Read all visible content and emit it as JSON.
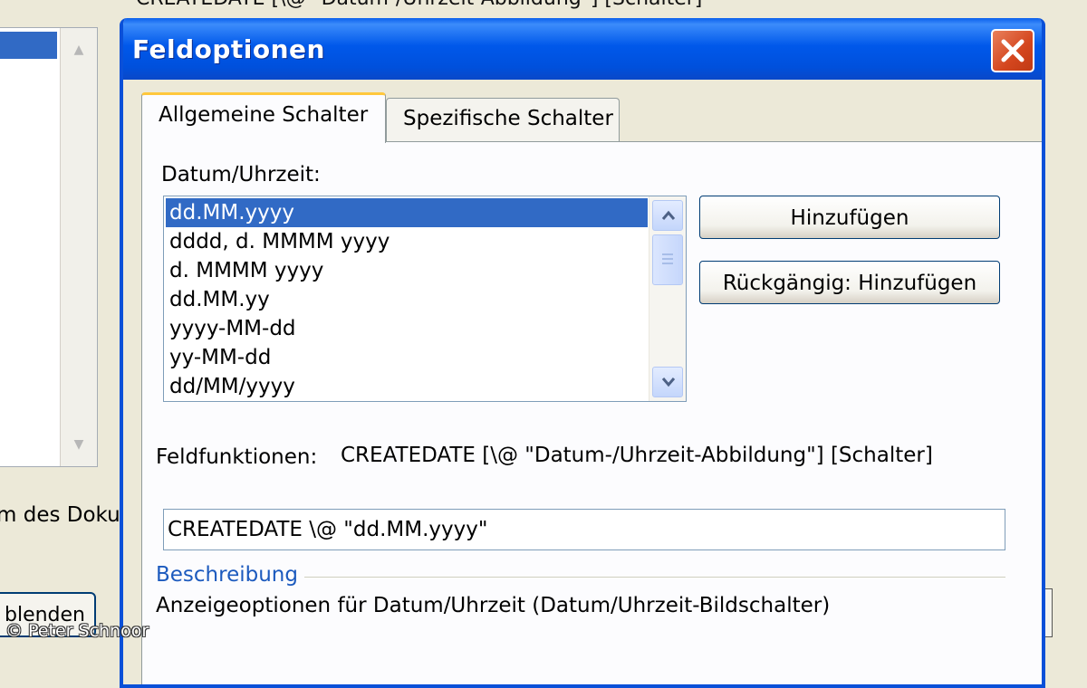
{
  "background": {
    "top_text": "CREATEDATE [\\@ \"Datum-/Uhrzeit-Abbildung\"] [Schalter]",
    "left_text": "m des Doku",
    "left_button_label": "blenden",
    "watermark": "© Peter Schnoor"
  },
  "dialog": {
    "title": "Feldoptionen",
    "tabs": [
      {
        "label": "Allgemeine Schalter",
        "active": true
      },
      {
        "label": "Spezifische Schalter",
        "active": false
      }
    ],
    "date_time_label": "Datum/Uhrzeit:",
    "formats": [
      "dd.MM.yyyy",
      "dddd, d. MMMM yyyy",
      "d. MMMM yyyy",
      "dd.MM.yy",
      "yyyy-MM-dd",
      "yy-MM-dd",
      "dd/MM/yyyy"
    ],
    "selected_format_index": 0,
    "buttons": {
      "add": "Hinzufügen",
      "undo_add": "Rückgängig: Hinzufügen"
    },
    "field_functions_label": "Feldfunktionen:",
    "field_functions_syntax": "CREATEDATE [\\@ \"Datum-/Uhrzeit-Abbildung\"] [Schalter]",
    "field_code_value": "CREATEDATE  \\@ \"dd.MM.yyyy\"",
    "description_header": "Beschreibung",
    "description_text": "Anzeigeoptionen für Datum/Uhrzeit (Datum/Uhrzeit-Bildschalter)"
  },
  "colors": {
    "titlebar": "#0058ea",
    "selection": "#316ac5",
    "close_button": "#d4461e",
    "description_header": "#1c5abe",
    "active_tab_accent": "#ffc73c"
  },
  "icons": {
    "close": "close-x-icon",
    "scroll_up": "chevron-up-icon",
    "scroll_down": "chevron-down-icon"
  }
}
